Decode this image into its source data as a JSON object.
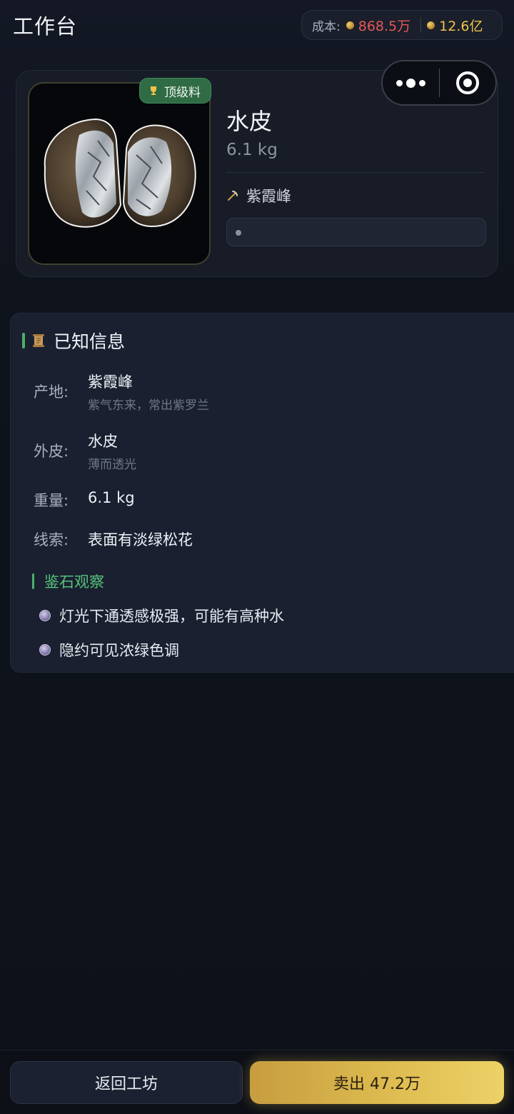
{
  "header": {
    "title": "工作台",
    "cost_label": "成本:",
    "cost_value": "868.5万",
    "money_value": "12.6亿"
  },
  "capsule": {
    "more_icon": "more-dots-icon",
    "close_icon": "target-circle-icon"
  },
  "stone": {
    "badge": "顶级料",
    "name": "水皮",
    "weight": "6.1 kg",
    "origin": "紫霞峰",
    "progress": 0
  },
  "info": {
    "title": "已知信息",
    "rows": [
      {
        "label": "产地:",
        "value": "紫霞峰",
        "sub": "紫气东来，常出紫罗兰"
      },
      {
        "label": "外皮:",
        "value": "水皮",
        "sub": "薄而透光"
      },
      {
        "label": "重量:",
        "value": "6.1 kg",
        "sub": ""
      },
      {
        "label": "线索:",
        "value": "表面有淡绿松花",
        "sub": ""
      }
    ],
    "observe_title": "鉴石观察",
    "observations": [
      "灯光下通透感极强，可能有高种水",
      "隐约可见浓绿色调"
    ]
  },
  "actions": {
    "back": "返回工坊",
    "sell": "卖出 47.2万"
  },
  "colors": {
    "cost": "#e45757",
    "money": "#f0c24a",
    "accent_green": "#4caf6a",
    "sell_gold": "#dcb94e"
  }
}
